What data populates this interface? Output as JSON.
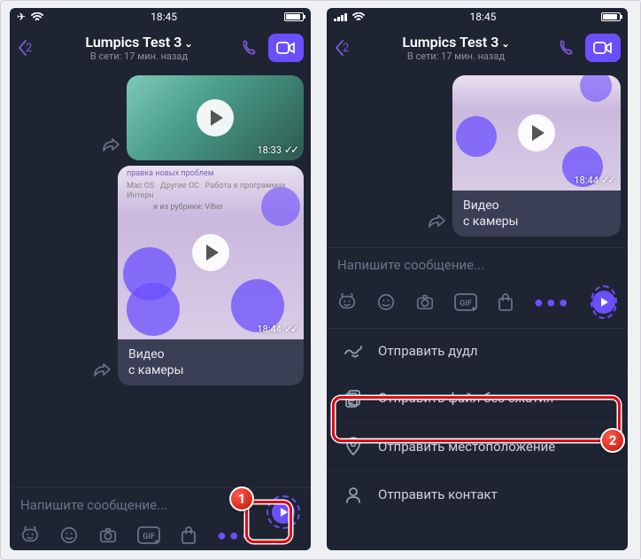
{
  "status": {
    "time": "18:45"
  },
  "header": {
    "back_count": "2",
    "title": "Lumpics Test 3",
    "subtitle": "В сети: 17 мин. назад"
  },
  "msg1": {
    "time": "18:33"
  },
  "msg2": {
    "time": "18:44",
    "caption_l1": "Видео",
    "caption_l2": "с камеры"
  },
  "msg3": {
    "time": "18:44",
    "caption_l1": "Видео",
    "caption_l2": "с камеры"
  },
  "input": {
    "placeholder": "Напишите сообщение..."
  },
  "sheet": {
    "doodle": "Отправить дудл",
    "file": "Отправить файл без сжатия",
    "location": "Отправить местоположение",
    "contact": "Отправить контакт"
  },
  "badges": {
    "one": "1",
    "two": "2"
  }
}
